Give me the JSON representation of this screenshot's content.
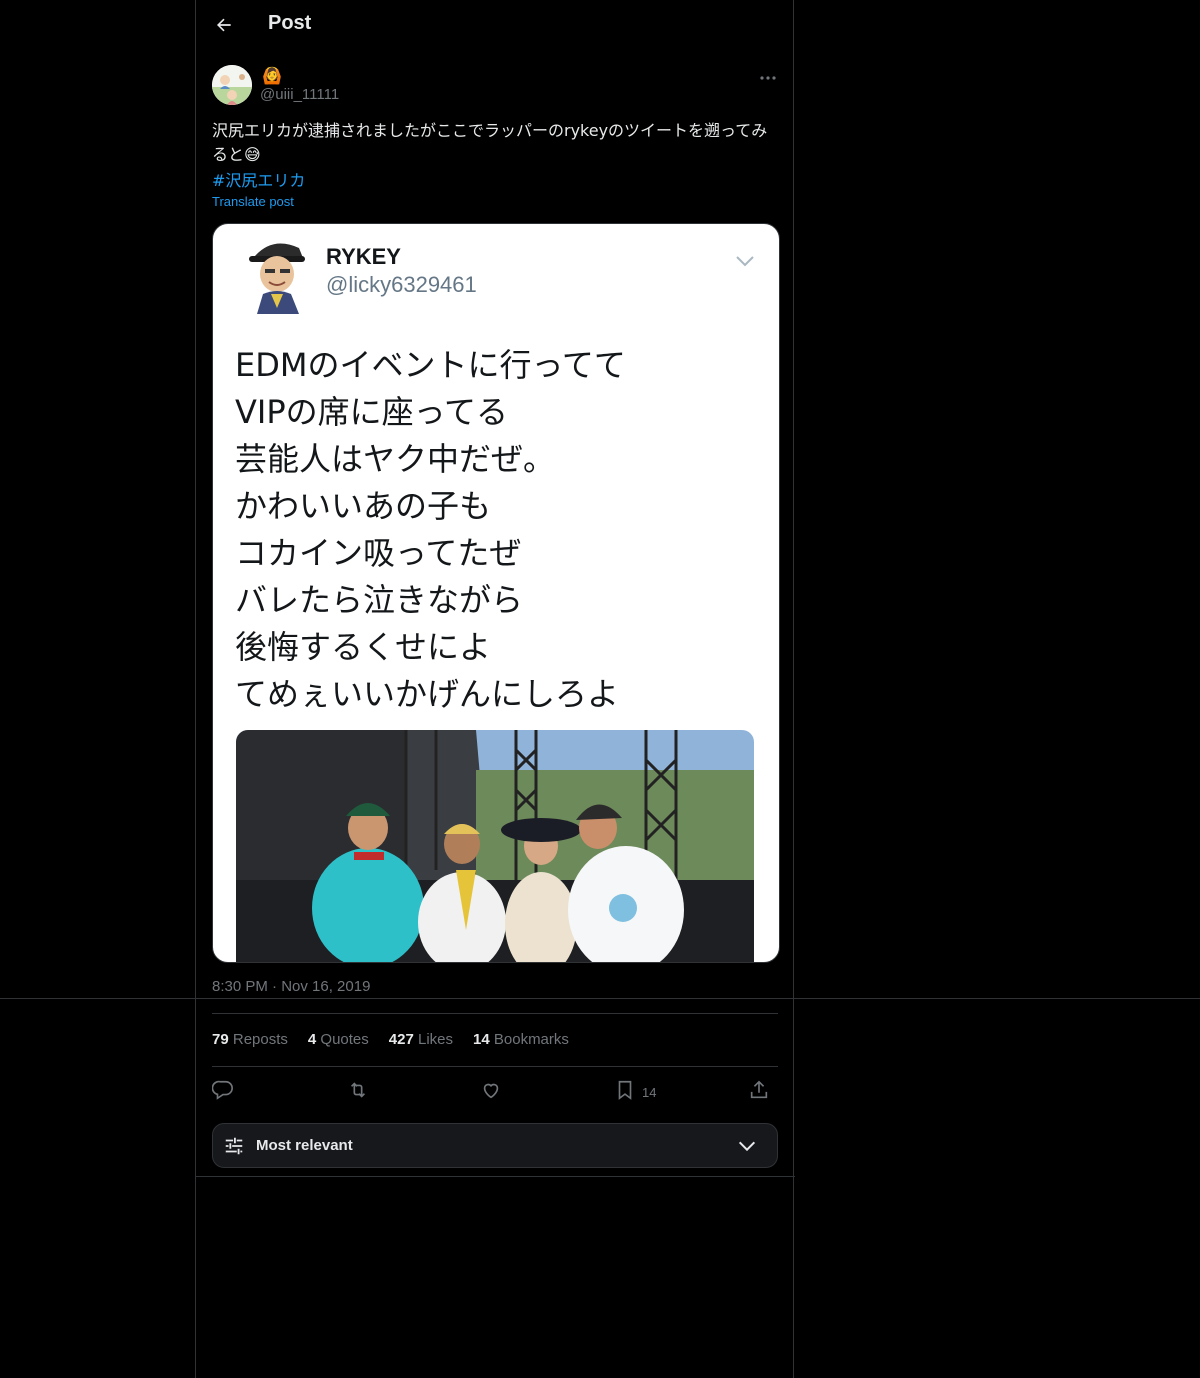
{
  "header": {
    "title": "Post"
  },
  "author": {
    "badge_emoji": "🙆",
    "handle": "@uiii_11111"
  },
  "post": {
    "text": "沢尻エリカが逮捕されましたがここでラッパーのrykeyのツイートを遡ってみると😅",
    "hashtag": "#沢尻エリカ",
    "translate_label": "Translate post"
  },
  "media": {
    "quoted_name": "RYKEY",
    "quoted_handle": "@licky6329461",
    "lines": [
      "EDMのイベントに行ってて",
      "VIPの席に座ってる",
      "芸能人はヤク中だぜ。",
      "かわいいあの子も",
      "コカイン吸ってたぜ",
      "バレたら泣きながら",
      "後悔するくせによ",
      "てめぇいいかげんにしろよ"
    ]
  },
  "meta": {
    "timestamp": "8:30 PM · Nov 16, 2019"
  },
  "stats": [
    {
      "count": "79",
      "label": "Reposts"
    },
    {
      "count": "4",
      "label": "Quotes"
    },
    {
      "count": "427",
      "label": "Likes"
    },
    {
      "count": "14",
      "label": "Bookmarks"
    }
  ],
  "actions": {
    "bookmark_count": "14"
  },
  "sort": {
    "label": "Most relevant"
  },
  "colors": {
    "background": "#000000",
    "accent": "#1d9bf0",
    "border": "#2f3336",
    "muted": "#71767b",
    "text": "#e7e9ea"
  },
  "icons": [
    "back-arrow-icon",
    "more-icon",
    "chevron-down-icon",
    "reply-icon",
    "repost-icon",
    "like-icon",
    "bookmark-icon",
    "share-icon",
    "sliders-icon"
  ]
}
